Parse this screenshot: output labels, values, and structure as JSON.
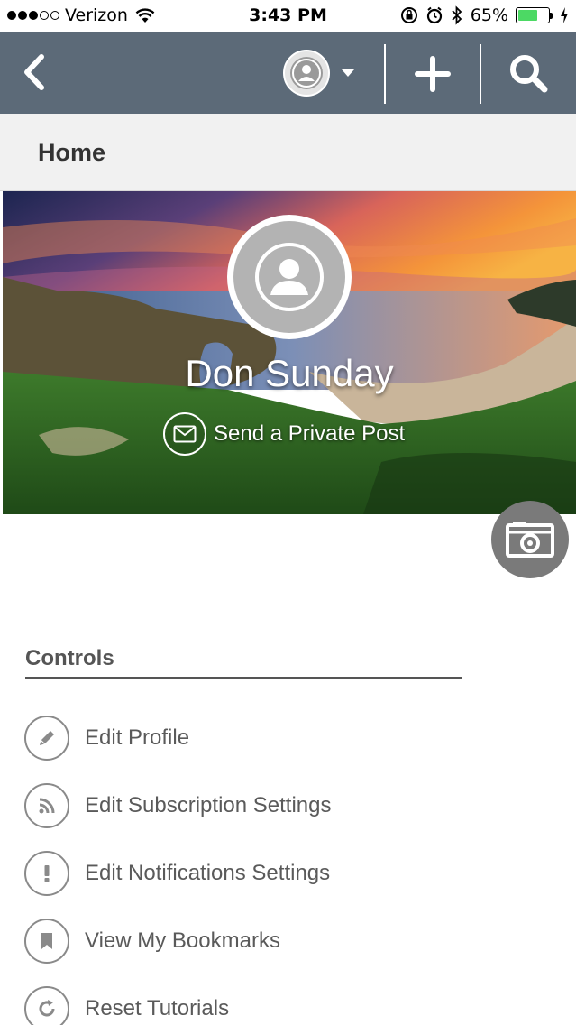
{
  "status_bar": {
    "carrier": "Verizon",
    "time": "3:43 PM",
    "battery": "65%",
    "battery_level": 0.65,
    "signal_bars_filled": 3,
    "signal_bars_total": 5
  },
  "nav": {
    "icons": [
      "back-chevron-icon",
      "avatar-icon",
      "caret-down-icon",
      "plus-icon",
      "search-icon"
    ]
  },
  "breadcrumb": {
    "label": "Home"
  },
  "profile": {
    "name": "Don Sunday",
    "private_post_label": "Send a Private Post"
  },
  "controls": {
    "heading": "Controls",
    "items": [
      {
        "label": "Edit Profile",
        "icon": "pencil-icon"
      },
      {
        "label": "Edit Subscription Settings",
        "icon": "rss-icon"
      },
      {
        "label": "Edit Notifications Settings",
        "icon": "exclamation-icon"
      },
      {
        "label": "View My Bookmarks",
        "icon": "bookmark-icon"
      },
      {
        "label": "Reset Tutorials",
        "icon": "refresh-icon"
      }
    ]
  },
  "colors": {
    "nav_bar": "#5c6a78",
    "breadcrumb_bg": "#f1f1f1",
    "battery_green": "#4cd964",
    "camera_button": "#7a7a7a",
    "text_gray": "#5a5a5a"
  }
}
